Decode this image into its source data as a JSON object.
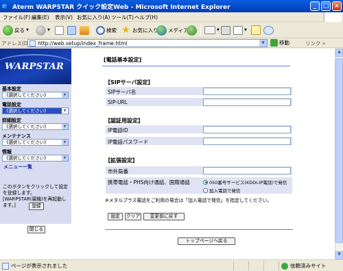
{
  "window": {
    "title": "Aterm WARPSTAR クイック設定Web - Microsoft Internet Explorer",
    "minimize": "_",
    "maximize": "□",
    "close": "×"
  },
  "menubar": [
    "ファイル(F)",
    "編集(E)",
    "表示(V)",
    "お気に入り(A)",
    "ツール(T)",
    "ヘルプ(H)"
  ],
  "toolbar": {
    "back": "戻る",
    "search": "検索",
    "favorites": "お気に入り",
    "media": "メディア"
  },
  "address": {
    "label": "アドレス(D)",
    "url": "http://web.setup/index_frame.html",
    "go": "移動",
    "links": "リンク »"
  },
  "left": {
    "logo": "WARPSTAR",
    "sections": [
      {
        "label": "基本設定",
        "value": "《選択してください》"
      },
      {
        "label": "電話設定",
        "value": "《選択してください》"
      },
      {
        "label": "詳細設定",
        "value": "《選択してください》"
      },
      {
        "label": "メンテナンス",
        "value": "《選択してください》"
      },
      {
        "label": "情報",
        "value": "《選択してください》"
      }
    ],
    "menu_list": "メニュー一覧",
    "hint": "このボタンをクリックして設定を登録します。[WARPSTAR(親機)を再起動します。]",
    "register": "登録",
    "close": "閉じる"
  },
  "main": {
    "title": "[電話基本設定]",
    "sip_section": "【SIPサーバ設定】",
    "sip_server_name": "SIPサーバ名",
    "sip_url": "SIP-URL",
    "auth_section": "【認証用設定】",
    "ip_phone_id": "IP電話ID",
    "ip_phone_password": "IP電話パスワード",
    "ext_section": "【拡張設定】",
    "area_code": "市外局番",
    "mobile_call": "携帯電話・PHS向け通話、国際通話",
    "radio_050": "050番号サービス(KDDI-IP電話)で発信",
    "radio_subscriber": "加入電話で発信",
    "note": "※メタルプラス電話をご利用の場合は「加入電話で発信」を指定してください。",
    "btn_set": "設定",
    "btn_clear": "クリア",
    "btn_revert": "変更前に戻す",
    "btn_top": "トップページへ戻る"
  },
  "status": {
    "left": "ページが表示されました",
    "zone": "信頼済みサイト"
  }
}
